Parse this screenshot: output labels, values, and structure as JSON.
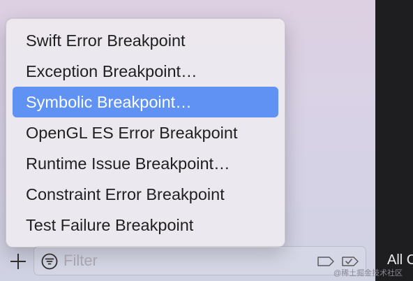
{
  "menu": {
    "items": [
      {
        "label": "Swift Error Breakpoint",
        "selected": false
      },
      {
        "label": "Exception Breakpoint…",
        "selected": false
      },
      {
        "label": "Symbolic Breakpoint…",
        "selected": true
      },
      {
        "label": "OpenGL ES Error Breakpoint",
        "selected": false
      },
      {
        "label": "Runtime Issue Breakpoint…",
        "selected": false
      },
      {
        "label": "Constraint Error Breakpoint",
        "selected": false
      },
      {
        "label": "Test Failure Breakpoint",
        "selected": false
      }
    ]
  },
  "bottom_bar": {
    "add_icon": "plus-icon",
    "filter_icon": "filter-icon",
    "filter_placeholder": "Filter",
    "filter_value": "",
    "tag_icon": "tag-icon",
    "enabled_icon": "checkmark-tag-icon"
  },
  "right_panel": {
    "label": "All C"
  },
  "watermark": "@稀土掘金技术社区",
  "colors": {
    "selection": "#5f92f2",
    "menu_background": "#ece8ee",
    "dark_panel": "#1e1e20"
  }
}
